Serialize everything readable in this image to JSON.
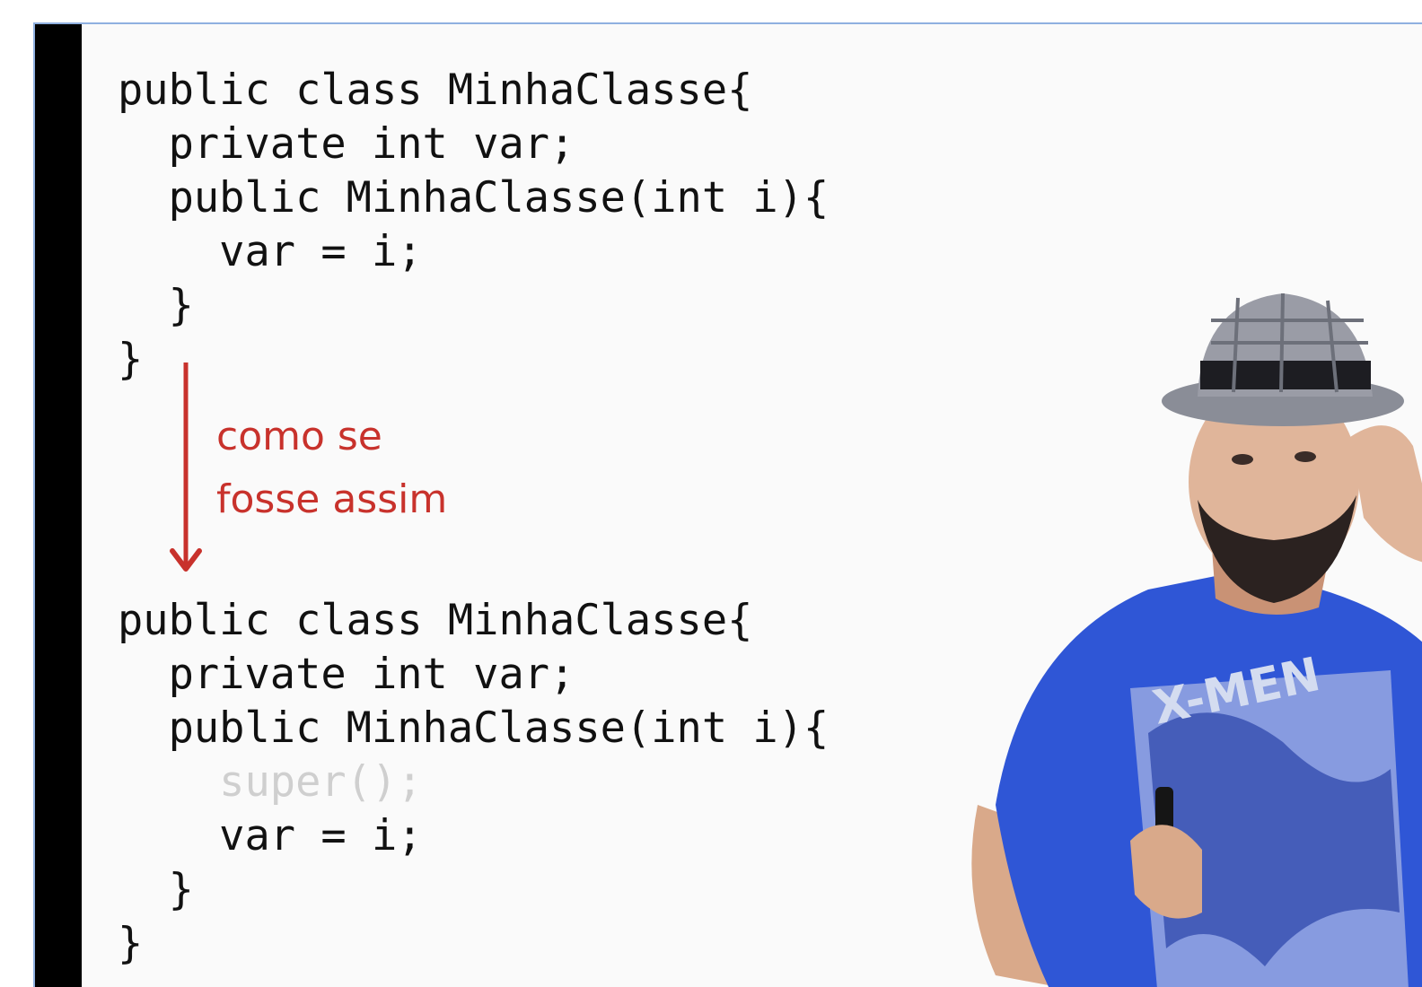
{
  "colors": {
    "frame_border": "#8fb0e0",
    "left_bar": "#000000",
    "code_text": "#111111",
    "ghost_text": "#cfcfcf",
    "annotation": "#c8322c"
  },
  "code_top": {
    "lines": [
      "public class MinhaClasse{",
      "  private int var;",
      "  public MinhaClasse(int i){",
      "    var = i;",
      "  }",
      "}"
    ]
  },
  "annotation": {
    "line1": "como se",
    "line2": "fosse assim",
    "arrow_icon": "arrow-down-icon"
  },
  "code_bottom": {
    "lines": [
      "public class MinhaClasse{",
      "  private int var;",
      "  public MinhaClasse(int i){",
      "    super();",
      "    var = i;",
      "  }",
      "}"
    ],
    "ghost_line": "    super();"
  },
  "presenter": {
    "shirt_text": "X-MEN",
    "image": "presenter-photo"
  }
}
